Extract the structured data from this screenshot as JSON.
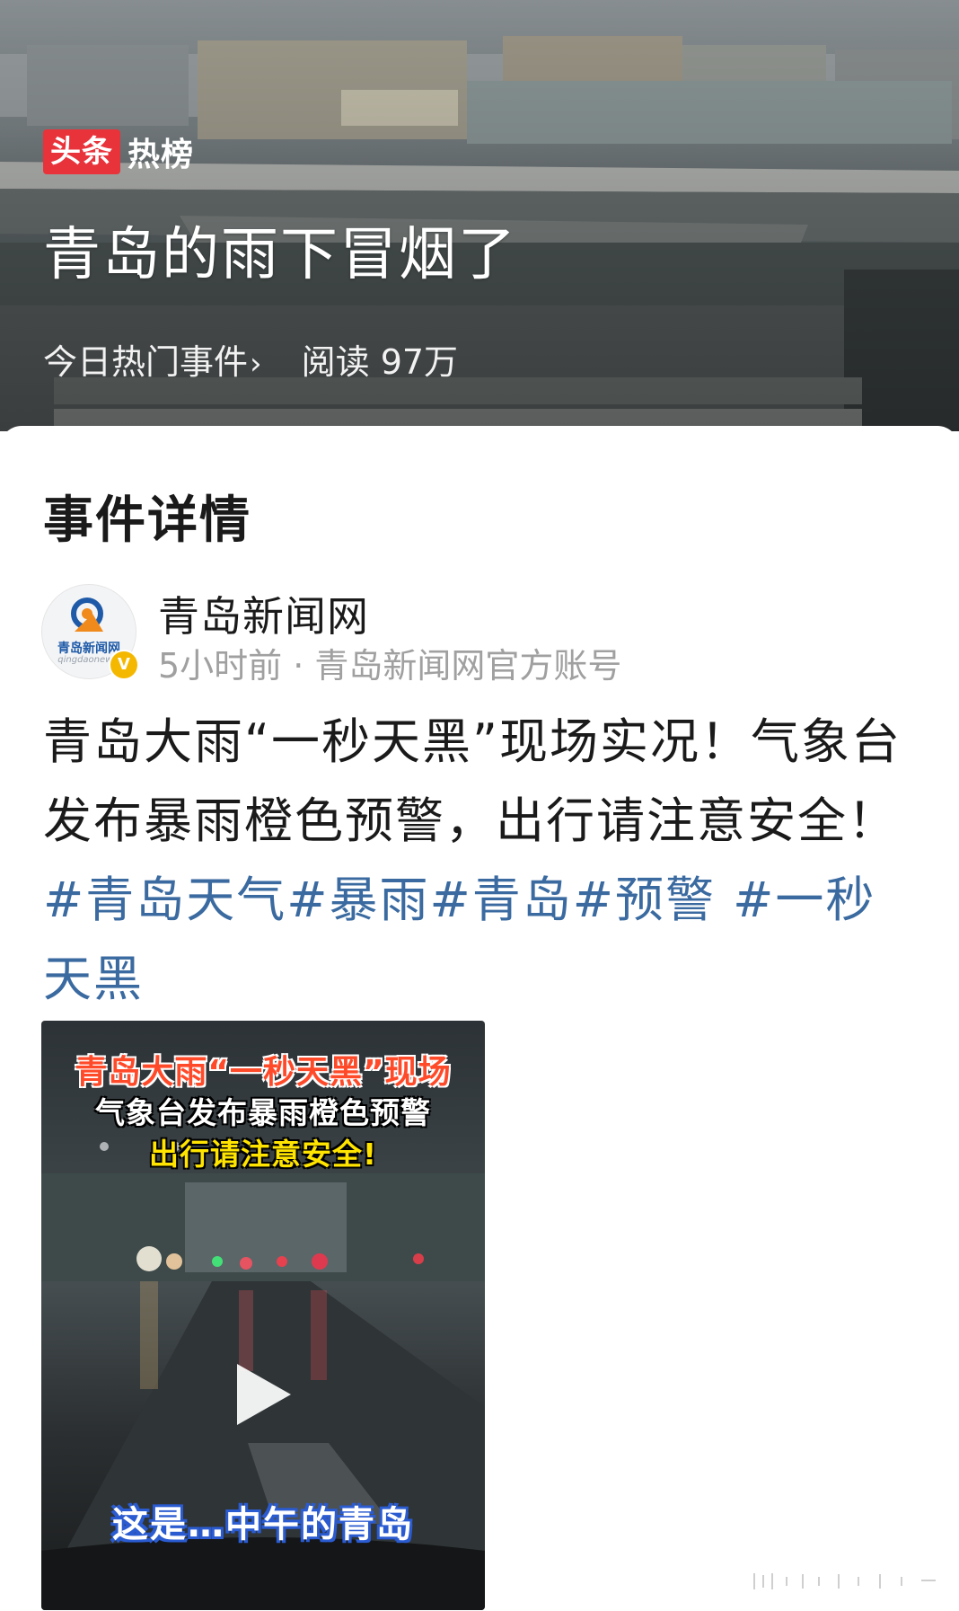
{
  "hero": {
    "brand_badge": "头条",
    "brand_text": "热榜",
    "title": "青岛的雨下冒烟了",
    "category_link": "今日热门事件",
    "chevron": "›",
    "reads": "阅读 97万"
  },
  "section": {
    "title": "事件详情"
  },
  "author": {
    "name": "青岛新闻网",
    "meta": "5小时前 · 青岛新闻网官方账号",
    "avatar_name": "青岛新闻网",
    "avatar_url": "qingdaonews.",
    "verified_mark": "V"
  },
  "post": {
    "text": "青岛大雨“一秒天黑”现场实况！气象台发布暴雨橙色预警，出行请注意安全！",
    "hashtags": [
      "#青岛天气",
      "#暴雨#青岛",
      "#预警",
      "#一秒天黑"
    ]
  },
  "video": {
    "caption_line1": "青岛大雨“一秒天黑”现场",
    "caption_line2": "气象台发布暴雨橙色预警",
    "caption_line3": "出行请注意安全!",
    "subtitle": "这是…中午的青岛"
  },
  "colors": {
    "brand_red": "#e8333b",
    "hashtag_blue": "#3a6aa0",
    "meta_gray": "#a0a0a0"
  },
  "icons": {
    "play": "play-icon",
    "verified": "verified-badge-icon",
    "chevron": "chevron-right-icon"
  }
}
